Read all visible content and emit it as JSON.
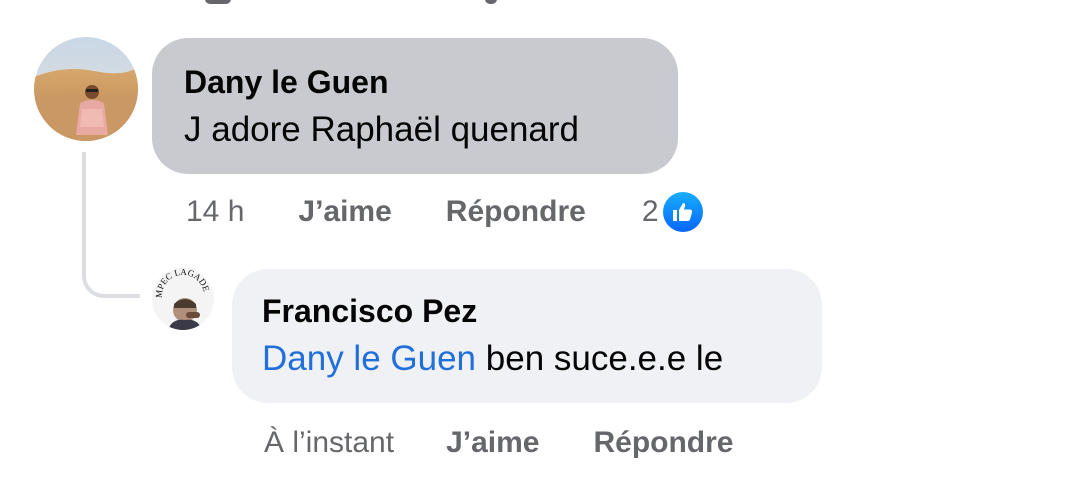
{
  "comment": {
    "author": "Dany le Guen",
    "text": "J adore Raphaël quenard",
    "time": "14 h",
    "like_label": "J’aime",
    "reply_label": "Répondre",
    "reaction_count": "2",
    "reaction_icon": "thumbs-up-icon",
    "reaction_color": "#0866ff"
  },
  "reply": {
    "author": "Francisco Pez",
    "mention": "Dany le Guen",
    "text": "ben suce.e.e le",
    "time": "À l’instant",
    "like_label": "J’aime",
    "reply_label": "Répondre",
    "mention_color": "#216fdb"
  },
  "colors": {
    "bubble_comment": "#c9cacf",
    "bubble_reply": "#f0f1f4",
    "meta_text": "#65676b"
  }
}
